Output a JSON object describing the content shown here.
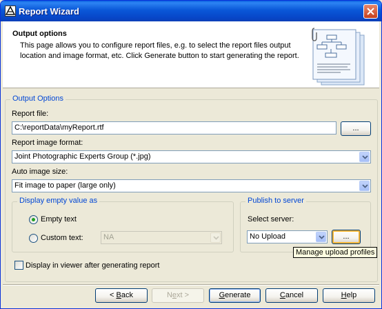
{
  "window": {
    "title": "Report Wizard",
    "close_icon": "close-icon",
    "app_icon": "magicdraw-icon"
  },
  "header": {
    "title": "Output options",
    "description": "This page allows you to configure report files, e.g. to select the report files output location and image format, etc. Click Generate button to start generating the report.",
    "illustration_icon": "report-documents-icon"
  },
  "output_options": {
    "legend": "Output Options",
    "report_file_label": "Report file:",
    "report_file_value": "C:\\reportData\\myReport.rtf",
    "browse_label": "...",
    "image_format_label": "Report image format:",
    "image_format_value": "Joint Photographic Experts Group (*.jpg)",
    "auto_size_label": "Auto image size:",
    "auto_size_value": "Fit image to paper (large only)"
  },
  "empty_value": {
    "legend": "Display empty value as",
    "empty_text_label": "Empty text",
    "empty_text_selected": true,
    "custom_text_label": "Custom text:",
    "custom_text_value": "NA"
  },
  "publish": {
    "legend": "Publish to server",
    "select_server_label": "Select server:",
    "server_value": "No Upload",
    "manage_button_label": "...",
    "tooltip": "Manage upload profiles"
  },
  "display_in_viewer": {
    "label": "Display in viewer after generating report",
    "checked": false
  },
  "footer": {
    "back_prefix": "< ",
    "back_mnemonic": "B",
    "back_rest": "ack",
    "next_prefix": "N",
    "next_mnemonic": "e",
    "next_rest": "xt >",
    "generate_mnemonic": "G",
    "generate_rest": "enerate",
    "cancel_mnemonic": "C",
    "cancel_rest": "ancel",
    "help_mnemonic": "H",
    "help_rest": "elp"
  }
}
